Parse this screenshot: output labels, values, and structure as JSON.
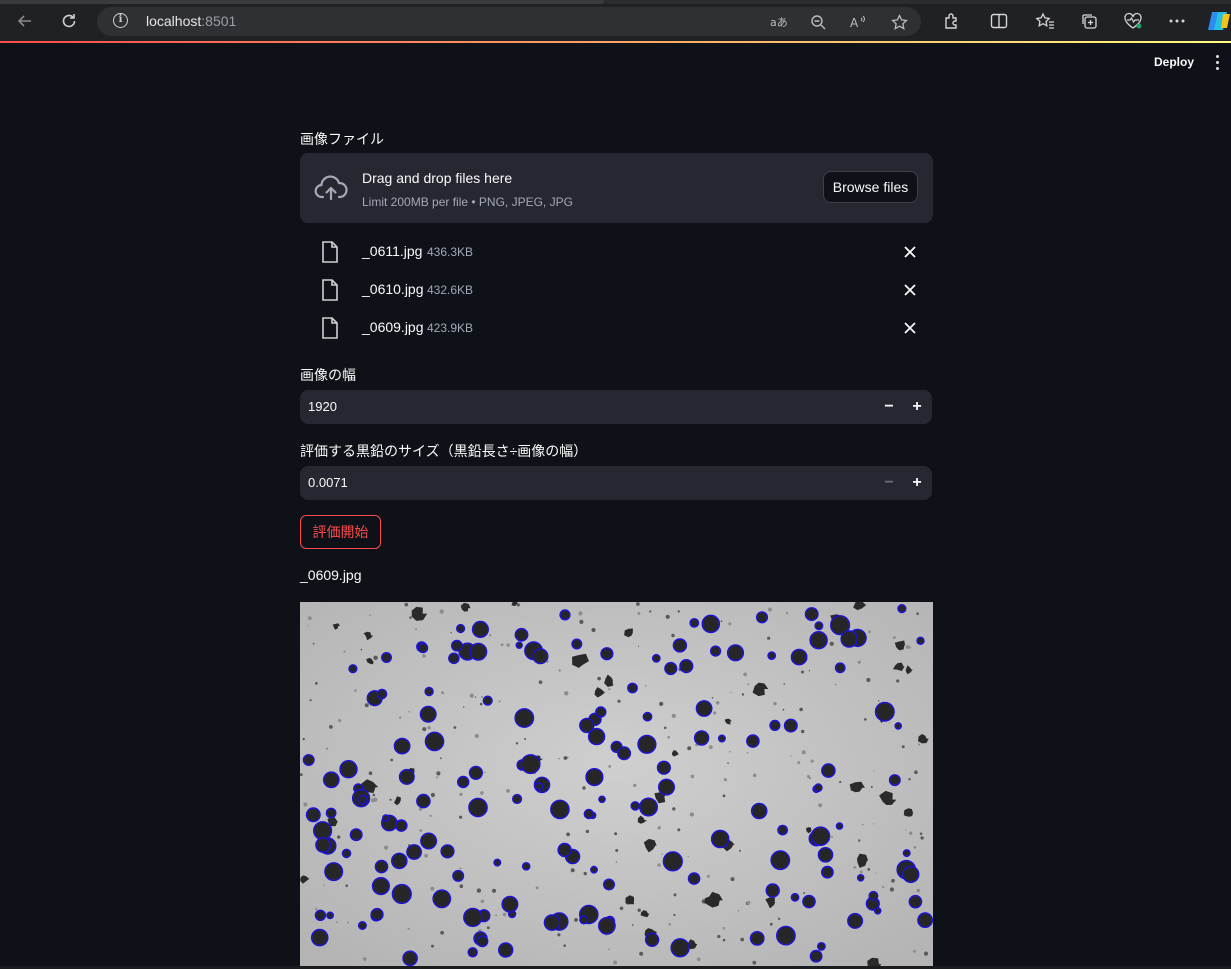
{
  "browser": {
    "url_host": "localhost",
    "url_port": ":8501",
    "icons": [
      "back-arrow-icon",
      "refresh-icon",
      "info-icon",
      "translate-icon",
      "zoom-out-icon",
      "read-aloud-icon",
      "favorite-star-icon",
      "extensions-icon",
      "split-screen-icon",
      "favorites-icon",
      "collections-icon",
      "browser-essentials-icon",
      "more-icon",
      "copilot-icon"
    ],
    "accent_gradient": [
      "#ff4b4b",
      "#fffd80"
    ]
  },
  "header": {
    "deploy_label": "Deploy"
  },
  "uploader": {
    "label": "画像ファイル",
    "title": "Drag and drop files here",
    "subtitle": "Limit 200MB per file • PNG, JPEG, JPG",
    "browse_label": "Browse files",
    "files": [
      {
        "name": "_0611.jpg",
        "size": "436.3KB"
      },
      {
        "name": "_0610.jpg",
        "size": "432.6KB"
      },
      {
        "name": "_0609.jpg",
        "size": "423.9KB"
      }
    ]
  },
  "width_input": {
    "label": "画像の幅",
    "value": "1920"
  },
  "size_input": {
    "label": "評価する黒鉛のサイズ（黒鉛長さ÷画像の幅）",
    "value": "0.0071"
  },
  "evaluate_button": {
    "label": "評価開始",
    "color": "#ff4b4b"
  },
  "result": {
    "caption": "_0609.jpg",
    "detection_color": "#1a12d8"
  },
  "theme": {
    "background": "#0e1117",
    "widget_background": "#262730"
  }
}
